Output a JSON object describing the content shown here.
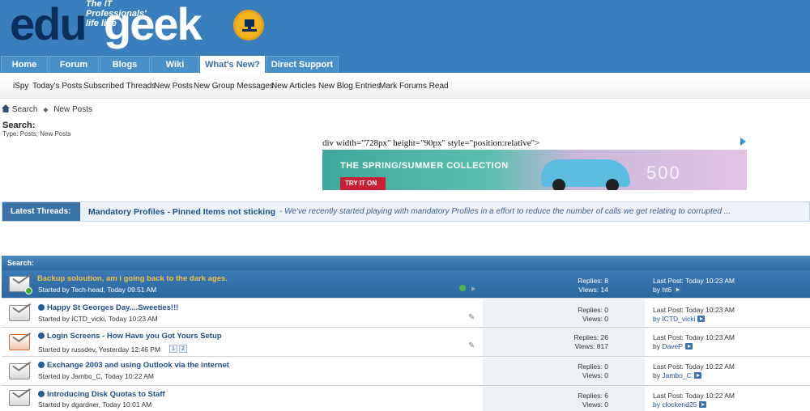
{
  "header": {
    "logo_primary": "edu",
    "logo_secondary": "geek",
    "tagline": "The IT Professionals' life line"
  },
  "nav": {
    "tabs": [
      "Home",
      "Forum",
      "Blogs",
      "Wiki",
      "What's New?",
      "Direct Support"
    ],
    "active_tab": "What's New?"
  },
  "subnav": {
    "links": [
      "iSpy",
      "Today's Posts",
      "Subscribed Threads",
      "New Posts",
      "New Group Messages",
      "New Articles",
      "New Blog Entries",
      "Mark Forums Read"
    ]
  },
  "breadcrumb": {
    "items": [
      "Search",
      "New Posts"
    ]
  },
  "search": {
    "title": "Search:",
    "type": "Type: Posts; New Posts"
  },
  "ad": {
    "raw_text": "div width=\"728px\" height=\"90px\" style=\"position:relative\">",
    "headline": "THE SPRING/SUMMER COLLECTION",
    "cta": "TRY IT ON",
    "model": "500"
  },
  "latest_threads": {
    "label": "Latest Threads:",
    "title": "Mandatory Profiles - Pinned Items not sticking",
    "excerpt": " - We've recently started playing with mandatory Profiles in a effort to reduce the number of calls we get relating to corrupted ..."
  },
  "results": {
    "header": "Search:",
    "threads": [
      {
        "title": "Backup soloution, am i going back to the dark ages.",
        "started": "Started by Tech-head, Today 09:51 AM",
        "replies": "Replies: 8",
        "views": "Views: 14",
        "last_post": "Last Post: Today 10:23 AM",
        "last_by": "by ht6"
      },
      {
        "title": "Happy St Georges Day....Sweeties!!!",
        "started": "Started by ICTD_vicki, Today 10:23 AM",
        "replies": "Replies: 0",
        "views": "Views: 0",
        "last_post": "Last Post: Today 10:23 AM",
        "last_by": "by ICTD_vicki"
      },
      {
        "title": "Login Screens - How Have you Got Yours Setup",
        "started": "Started by russdev, Yesterday 12:46 PM",
        "pages": [
          "1",
          "2"
        ],
        "replies": "Replies: 26",
        "views": "Views: 817",
        "last_post": "Last Post: Today 10:23 AM",
        "last_by": "DaveP"
      },
      {
        "title": "Exchange 2003 and using Outlook via the internet",
        "started": "Started by Jambo_C, Today 10:22 AM",
        "replies": "Replies: 0",
        "views": "Views: 0",
        "last_post": "Last Post: Today 10:22 AM",
        "last_by": "Jambo_C"
      },
      {
        "title": "Introducing Disk Quotas to Staff",
        "started": "Started by dgardner, Today 10:01 AM",
        "replies": "Replies: 6",
        "views": "Views: 0",
        "last_post": "Last Post: Today 10:22 AM",
        "last_by": "by clockend25"
      }
    ]
  }
}
